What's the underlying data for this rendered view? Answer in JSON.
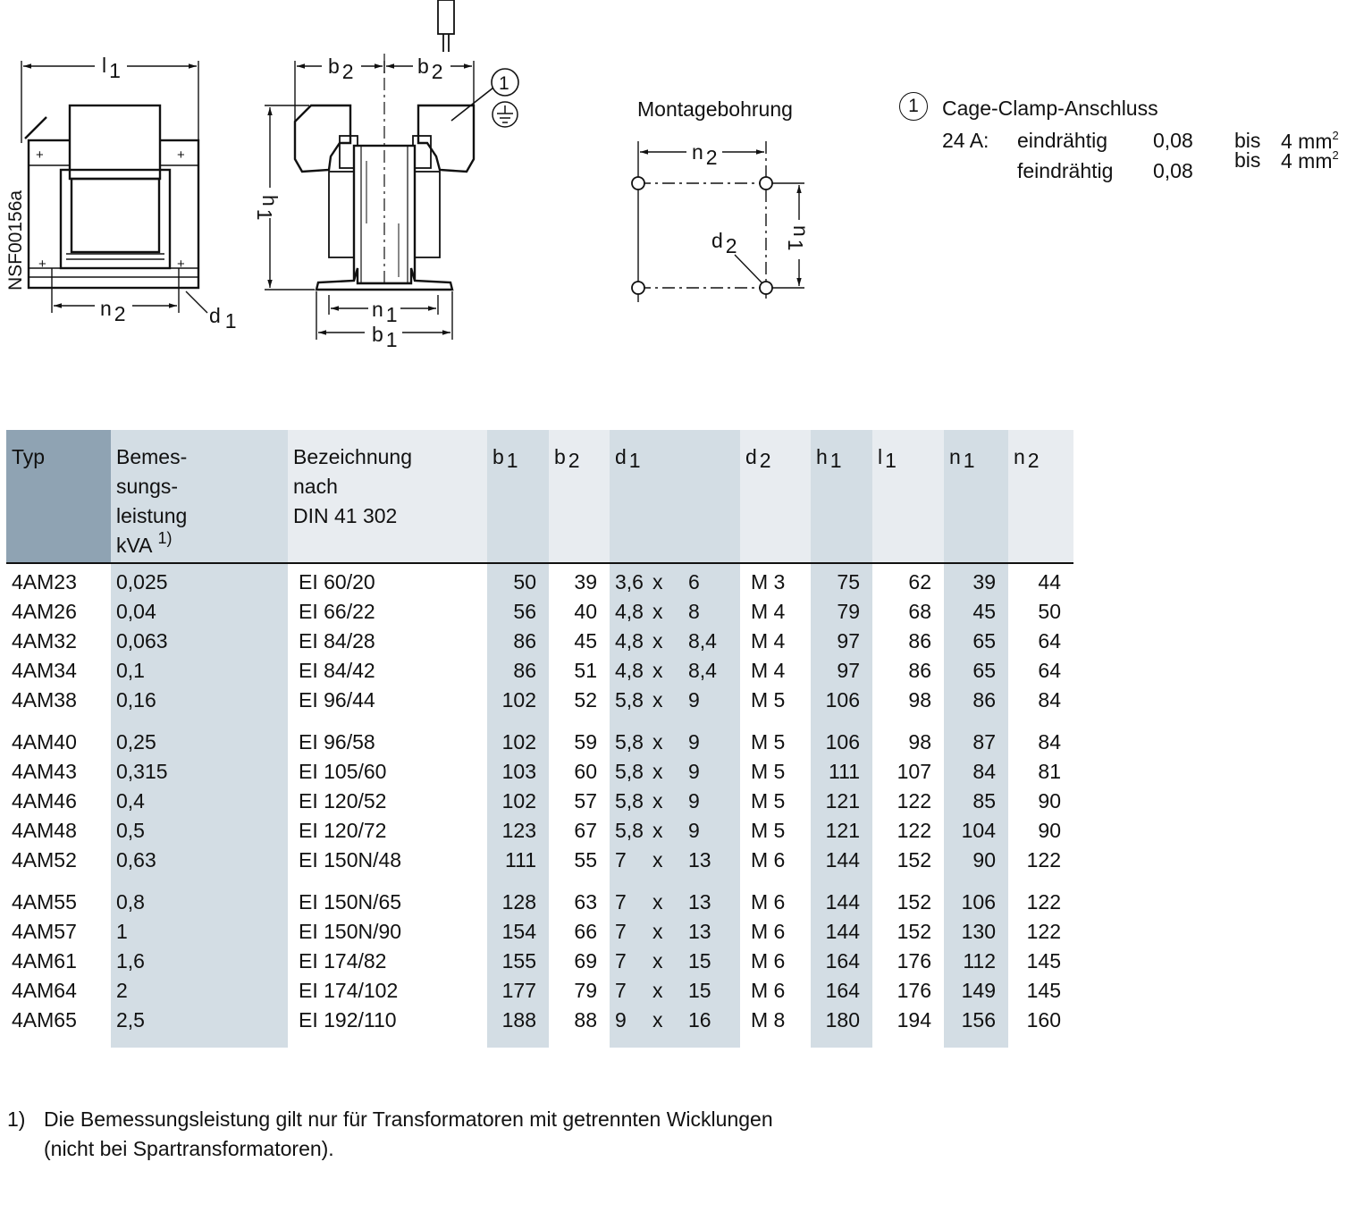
{
  "drawing": {
    "code": "NSF00156a",
    "front_view": {
      "l1": "l",
      "l1_sub": "1",
      "n2": "n",
      "n2_sub": "2",
      "d1": "d",
      "d1_sub": "1",
      "plus": "+"
    },
    "side_view": {
      "b2": "b",
      "b2_sub": "2",
      "h1": "h",
      "h1_sub": "1",
      "n1": "n",
      "n1_sub": "1",
      "b1": "b",
      "b1_sub": "1",
      "marker": "1"
    },
    "mounting": {
      "title": "Montagebohrung",
      "n2": "n",
      "n2_sub": "2",
      "n1": "n",
      "n1_sub": "1",
      "d2": "d",
      "d2_sub": "2"
    },
    "colors": {
      "line": "#111111",
      "table_dark": "#8fa3b3",
      "table_shade": "#d3dde4",
      "table_light": "#e8ecf0"
    }
  },
  "legend": {
    "marker": "1",
    "title": "Cage-Clamp-Anschluss",
    "current": "24 A:",
    "rows": [
      {
        "type": "eindrähtig",
        "from": "0,08",
        "to_word": "bis",
        "to_value": "4 mm",
        "sup": "2"
      },
      {
        "type": "feindrähtig",
        "from": "0,08",
        "to_word": "bis",
        "to_value": "4 mm",
        "sup": "2"
      }
    ]
  },
  "table": {
    "headers": {
      "typ": "Typ",
      "leistung": [
        "Bemes-",
        "sungs-",
        "leistung",
        "kVA"
      ],
      "leistung_note": "1)",
      "bezeichnung": [
        "Bezeichnung",
        "nach",
        "DIN 41 302"
      ],
      "b1": [
        "b",
        "1"
      ],
      "b2": [
        "b",
        "2"
      ],
      "d1": [
        "d",
        "1"
      ],
      "d2": [
        "d",
        "2"
      ],
      "h1": [
        "h",
        "1"
      ],
      "l1": [
        "l",
        "1"
      ],
      "n1": [
        "n",
        "1"
      ],
      "n2": [
        "n",
        "2"
      ]
    },
    "rows": [
      {
        "typ": "4AM23",
        "kva": "0,025",
        "bez": "EI 60/20",
        "b1": "50",
        "b2": "39",
        "d1a": "3,6",
        "d1x": "x",
        "d1b": "6",
        "d2": "M 3",
        "h1": "75",
        "l1": "62",
        "n1": "39",
        "n2": "44"
      },
      {
        "typ": "4AM26",
        "kva": "0,04",
        "bez": "EI 66/22",
        "b1": "56",
        "b2": "40",
        "d1a": "4,8",
        "d1x": "x",
        "d1b": "8",
        "d2": "M 4",
        "h1": "79",
        "l1": "68",
        "n1": "45",
        "n2": "50"
      },
      {
        "typ": "4AM32",
        "kva": "0,063",
        "bez": "EI 84/28",
        "b1": "86",
        "b2": "45",
        "d1a": "4,8",
        "d1x": "x",
        "d1b": "8,4",
        "d2": "M 4",
        "h1": "97",
        "l1": "86",
        "n1": "65",
        "n2": "64"
      },
      {
        "typ": "4AM34",
        "kva": "0,1",
        "bez": "EI 84/42",
        "b1": "86",
        "b2": "51",
        "d1a": "4,8",
        "d1x": "x",
        "d1b": "8,4",
        "d2": "M 4",
        "h1": "97",
        "l1": "86",
        "n1": "65",
        "n2": "64"
      },
      {
        "typ": "4AM38",
        "kva": "0,16",
        "bez": "EI 96/44",
        "b1": "102",
        "b2": "52",
        "d1a": "5,8",
        "d1x": "x",
        "d1b": "9",
        "d2": "M 5",
        "h1": "106",
        "l1": "98",
        "n1": "86",
        "n2": "84"
      },
      {
        "typ": "4AM40",
        "kva": "0,25",
        "bez": "EI 96/58",
        "b1": "102",
        "b2": "59",
        "d1a": "5,8",
        "d1x": "x",
        "d1b": "9",
        "d2": "M 5",
        "h1": "106",
        "l1": "98",
        "n1": "87",
        "n2": "84"
      },
      {
        "typ": "4AM43",
        "kva": "0,315",
        "bez": "EI 105/60",
        "b1": "103",
        "b2": "60",
        "d1a": "5,8",
        "d1x": "x",
        "d1b": "9",
        "d2": "M 5",
        "h1": "111",
        "l1": "107",
        "n1": "84",
        "n2": "81"
      },
      {
        "typ": "4AM46",
        "kva": "0,4",
        "bez": "EI 120/52",
        "b1": "102",
        "b2": "57",
        "d1a": "5,8",
        "d1x": "x",
        "d1b": "9",
        "d2": "M 5",
        "h1": "121",
        "l1": "122",
        "n1": "85",
        "n2": "90"
      },
      {
        "typ": "4AM48",
        "kva": "0,5",
        "bez": "EI 120/72",
        "b1": "123",
        "b2": "67",
        "d1a": "5,8",
        "d1x": "x",
        "d1b": "9",
        "d2": "M 5",
        "h1": "121",
        "l1": "122",
        "n1": "104",
        "n2": "90"
      },
      {
        "typ": "4AM52",
        "kva": "0,63",
        "bez": "EI 150N/48",
        "b1": "111",
        "b2": "55",
        "d1a": "7",
        "d1x": "x",
        "d1b": "13",
        "d2": "M 6",
        "h1": "144",
        "l1": "152",
        "n1": "90",
        "n2": "122"
      },
      {
        "typ": "4AM55",
        "kva": "0,8",
        "bez": "EI 150N/65",
        "b1": "128",
        "b2": "63",
        "d1a": "7",
        "d1x": "x",
        "d1b": "13",
        "d2": "M 6",
        "h1": "144",
        "l1": "152",
        "n1": "106",
        "n2": "122"
      },
      {
        "typ": "4AM57",
        "kva": "1",
        "bez": "EI 150N/90",
        "b1": "154",
        "b2": "66",
        "d1a": "7",
        "d1x": "x",
        "d1b": "13",
        "d2": "M 6",
        "h1": "144",
        "l1": "152",
        "n1": "130",
        "n2": "122"
      },
      {
        "typ": "4AM61",
        "kva": "1,6",
        "bez": "EI 174/82",
        "b1": "155",
        "b2": "69",
        "d1a": "7",
        "d1x": "x",
        "d1b": "15",
        "d2": "M 6",
        "h1": "164",
        "l1": "176",
        "n1": "112",
        "n2": "145"
      },
      {
        "typ": "4AM64",
        "kva": "2",
        "bez": "EI 174/102",
        "b1": "177",
        "b2": "79",
        "d1a": "7",
        "d1x": "x",
        "d1b": "15",
        "d2": "M 6",
        "h1": "164",
        "l1": "176",
        "n1": "149",
        "n2": "145"
      },
      {
        "typ": "4AM65",
        "kva": "2,5",
        "bez": "EI 192/110",
        "b1": "188",
        "b2": "88",
        "d1a": "9",
        "d1x": "x",
        "d1b": "16",
        "d2": "M 8",
        "h1": "180",
        "l1": "194",
        "n1": "156",
        "n2": "160"
      }
    ]
  },
  "footnote": {
    "number": "1)",
    "lines": [
      "Die Bemessungsleistung gilt nur für Transformatoren mit getrennten Wicklungen",
      "(nicht bei Spartransformatoren)."
    ]
  }
}
